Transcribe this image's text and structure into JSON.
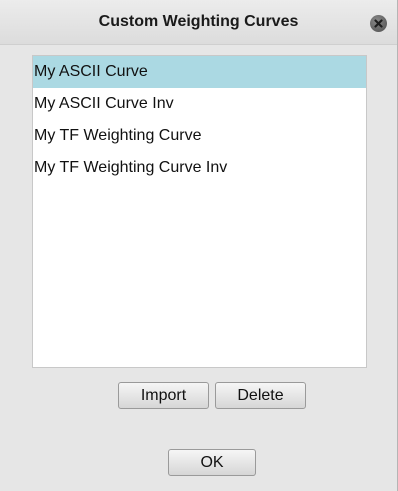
{
  "dialog": {
    "title": "Custom Weighting Curves"
  },
  "curves": {
    "selected_index": 0,
    "items": [
      "My ASCII Curve",
      "My ASCII Curve Inv",
      "My TF Weighting Curve",
      "My TF Weighting Curve Inv"
    ]
  },
  "buttons": {
    "import_label": "Import",
    "delete_label": "Delete",
    "ok_label": "OK"
  },
  "colors": {
    "selection": "#abd9e3",
    "dialog_background": "#e6e6e6"
  },
  "icons": {
    "close": "close-icon"
  }
}
